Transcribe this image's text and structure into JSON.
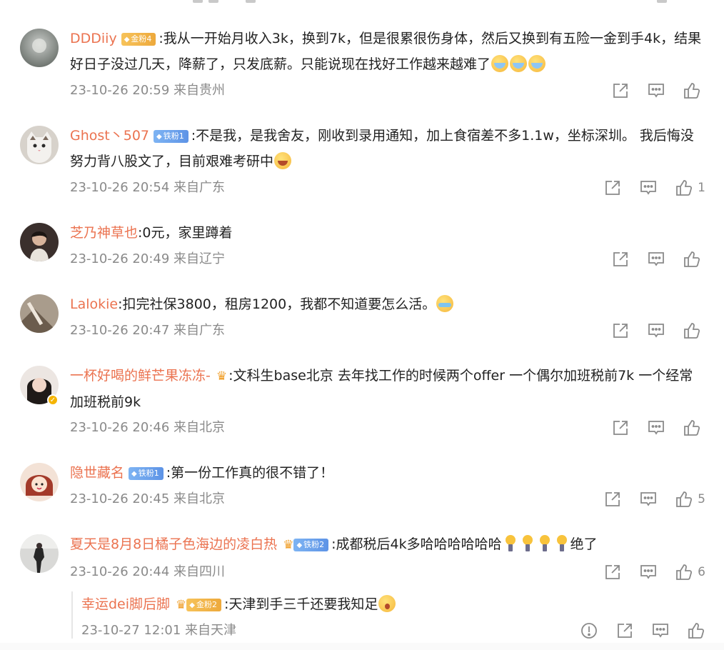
{
  "comments": [
    {
      "name": "DDDiiy",
      "badge": {
        "type": "gold",
        "label": "金粉4"
      },
      "text": ":我从一开始月收入3k，换到7k，但是很累很伤身体，然后又换到有五险一金到手4k，结果好日子没过几天，降薪了，只发底薪。只能说现在找好工作越来越难了",
      "emojis": [
        "cry-emoji",
        "cry-emoji",
        "cry-emoji"
      ],
      "time": "23-10-26 20:59",
      "location": "来自贵州",
      "likes": ""
    },
    {
      "name": "Ghost丶507",
      "badge": {
        "type": "iron",
        "label": "铁粉1"
      },
      "text": ":不是我，是我舍友，刚收到录用通知，加上食宿差不多1.1w，坐标深圳。 我后悔没努力背八股文了，目前艰难考研中",
      "emojis": [
        "lol-cry-emoji"
      ],
      "time": "23-10-26 20:54",
      "location": "来自广东",
      "likes": "1"
    },
    {
      "name": "芝乃神草也",
      "text": ":0元，家里蹲着",
      "time": "23-10-26 20:49",
      "location": "来自辽宁",
      "likes": ""
    },
    {
      "name": "Lalokie",
      "text": ":扣完社保3800，租房1200，我都不知道要怎么活。",
      "emojis": [
        "tears-emoji"
      ],
      "time": "23-10-26 20:47",
      "location": "来自广东",
      "likes": ""
    },
    {
      "name": "一杯好喝的鲜芒果冻冻-",
      "text": ":文科生base北京 去年找工作的时候两个offer 一个偶尔加班税前7k 一个经常加班税前9k",
      "time": "23-10-26 20:46",
      "location": "来自北京",
      "likes": ""
    },
    {
      "name": "隐世藏名",
      "badge": {
        "type": "iron",
        "label": "铁粉1"
      },
      "text": ":第一份工作真的很不错了！",
      "time": "23-10-26 20:45",
      "location": "来自北京",
      "likes": "5"
    },
    {
      "name": "夏天是8月8日橘子色海边的凌白热",
      "badge": {
        "type": "iron",
        "label": "铁粉2"
      },
      "text": ":成都税后4k多哈哈哈哈哈哈",
      "text_tail": "绝了",
      "emojis": [
        "bulb-emoji",
        "bulb-emoji",
        "bulb-emoji",
        "bulb-emoji"
      ],
      "time": "23-10-26 20:44",
      "location": "来自四川",
      "likes": "6"
    }
  ],
  "reply": {
    "name": "幸运dei脚后脚",
    "badge": {
      "type": "gold",
      "label": "金粉2"
    },
    "text": ":天津到手三千还要我知足",
    "emojis": [
      "shock-emoji"
    ],
    "time": "23-10-27 12:01",
    "location": "来自天津"
  },
  "icons": {
    "share": "share-icon",
    "comment": "comment-icon",
    "like": "like-icon",
    "report": "report-icon"
  },
  "colors": {
    "name": "#eb7350",
    "meta": "#8a8a8a",
    "gold_badge": "#eda93c",
    "iron_badge": "#5d93e6"
  }
}
